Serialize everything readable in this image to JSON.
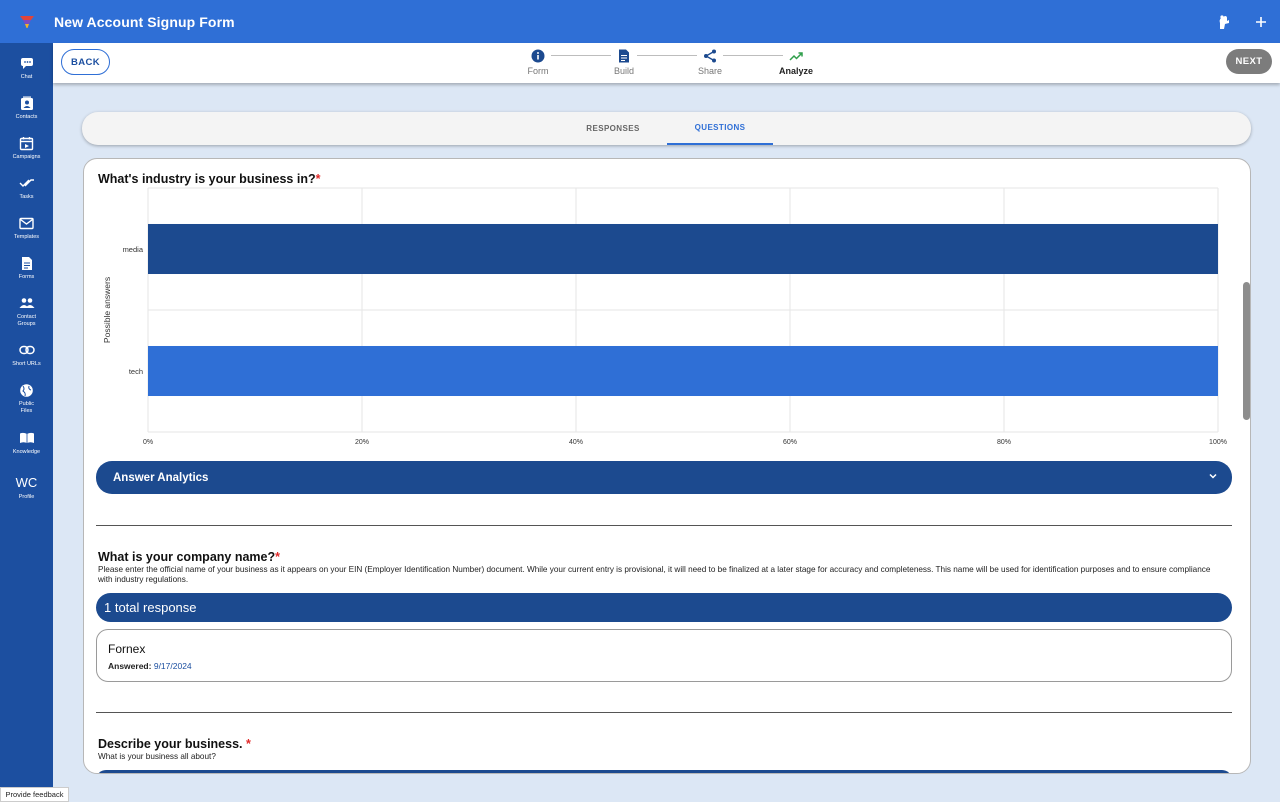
{
  "app": {
    "title": "New Account Signup Form"
  },
  "sidebar": {
    "items": [
      {
        "label": "Chat",
        "icon": "chat-icon"
      },
      {
        "label": "Contacts",
        "icon": "contacts-icon"
      },
      {
        "label": "Campaigns",
        "icon": "campaigns-icon"
      },
      {
        "label": "Tasks",
        "icon": "tasks-icon"
      },
      {
        "label": "Templates",
        "icon": "templates-icon"
      },
      {
        "label": "Forms",
        "icon": "forms-icon"
      },
      {
        "label": "Contact\nGroups",
        "icon": "contact-groups-icon"
      },
      {
        "label": "Short URLs",
        "icon": "link-icon"
      },
      {
        "label": "Public\nFiles",
        "icon": "globe-icon"
      },
      {
        "label": "Knowledge",
        "icon": "book-icon"
      },
      {
        "label": "Profile",
        "initials": "WC"
      }
    ]
  },
  "stepper": {
    "back_label": "BACK",
    "next_label": "NEXT",
    "steps": [
      {
        "label": "Form",
        "icon": "info-icon"
      },
      {
        "label": "Build",
        "icon": "document-icon"
      },
      {
        "label": "Share",
        "icon": "share-icon"
      },
      {
        "label": "Analyze",
        "icon": "trending-icon",
        "active": true
      }
    ]
  },
  "tabs": [
    {
      "label": "RESPONSES"
    },
    {
      "label": "QUESTIONS",
      "active": true
    }
  ],
  "questions": [
    {
      "title": "What's industry is your business in?",
      "required_mark": "*",
      "analytics_label": "Answer Analytics"
    },
    {
      "title": "What is your company name?",
      "required_mark": "*",
      "description": "Please enter the official name of your business as it appears on your EIN (Employer Identification Number) document. While your current entry is provisional, it will need to be finalized at a later stage for accuracy and completeness. This name will be used for identification purposes and to ensure compliance with industry regulations.",
      "response_count": "1 total response",
      "answer": "Fornex",
      "answered_label": "Answered:",
      "answered_date": "9/17/2024"
    },
    {
      "title": "Describe your business.",
      "required_mark": " *",
      "description": "What is your business all about?"
    }
  ],
  "chart_data": {
    "type": "bar",
    "orientation": "horizontal",
    "categories": [
      "media",
      "tech"
    ],
    "values": [
      100,
      100
    ],
    "ylabel": "Possible answers",
    "xticks": [
      "0%",
      "20%",
      "40%",
      "60%",
      "80%",
      "100%"
    ],
    "xlim": [
      0,
      100
    ],
    "colors": [
      "#1c4a8f",
      "#2f6fd6"
    ],
    "grid": true
  },
  "footer": {
    "feedback_label": "Provide feedback"
  },
  "colors": {
    "primary": "#2f6fd6",
    "primary_dark": "#1c4a8f",
    "sidebar": "#1c4fa0",
    "background": "#dce7f5",
    "required": "#e12a2a",
    "analyze_icon": "#2e9e4a"
  }
}
